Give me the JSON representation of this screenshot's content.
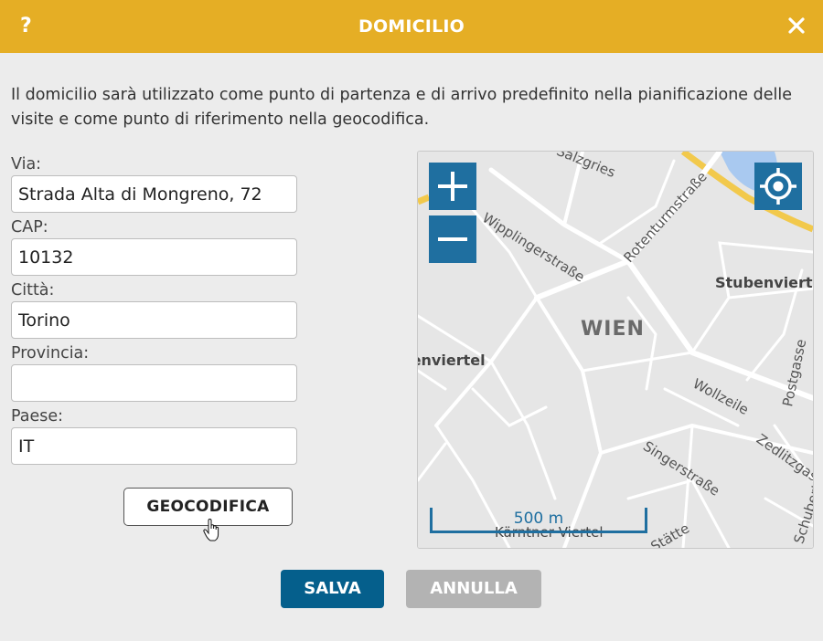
{
  "dialog": {
    "title": "DOMICILIO",
    "help_icon": "?",
    "description": "Il domicilio sarà utilizzato come punto di partenza e di arrivo predefinito nella pianificazione delle visite e come punto di riferimento nella geocodifica."
  },
  "form": {
    "via": {
      "label": "Via:",
      "value": "Strada Alta di Mongreno, 72"
    },
    "cap": {
      "label": "CAP:",
      "value": "10132"
    },
    "citta": {
      "label": "Città:",
      "value": "Torino"
    },
    "provincia": {
      "label": "Provincia:",
      "value": ""
    },
    "paese": {
      "label": "Paese:",
      "value": "IT"
    },
    "geocode_button": "GEOCODIFICA"
  },
  "map": {
    "labels": {
      "salzgries": "Salzgries",
      "wipplinger": "Wipplingerstraße",
      "rotenturm": "Rotenturmstraße",
      "stuben": "Stubenviertel",
      "wien": "WIEN",
      "schottenviertel": "Schottenviertel",
      "wollzeile": "Wollzeile",
      "postgasse": "Postgasse",
      "zedlitz": "Zedlitzgasse",
      "singer": "Singerstraße",
      "kaerntner": "Kärntner Viertel",
      "ring": "Schubertring",
      "statte": "Stätte"
    },
    "scale_label": "500 m",
    "zoom_in": "+",
    "zoom_out": "−",
    "colors": {
      "control": "#1f6fa0",
      "road_major": "#f2c94c",
      "water": "#a9c9f0"
    }
  },
  "actions": {
    "save": "SALVA",
    "cancel": "ANNULLA"
  },
  "colors": {
    "header": "#e5ae25",
    "primary": "#055f8c",
    "disabled": "#b3b3b3"
  }
}
